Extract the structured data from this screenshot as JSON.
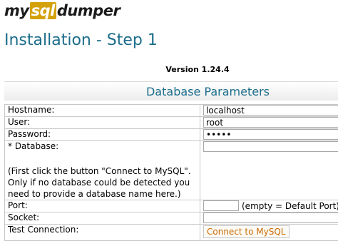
{
  "logo": {
    "part1": "my",
    "part2": "sql",
    "part3": "dumper"
  },
  "page": {
    "title": "Installation - Step 1",
    "version": "Version 1.24.4",
    "section_title": "Database Parameters"
  },
  "form": {
    "hostname_label": "Hostname:",
    "hostname_value": "localhost",
    "user_label": "User:",
    "user_value": "root",
    "password_label": "Password:",
    "password_value": "•••••",
    "database_label": "* Database:",
    "database_value": "",
    "database_note": "(First click the button \"Connect to MySQL\". Only if no database could be detected you need to provide a database name here.)",
    "port_label": "Port:",
    "port_value": "",
    "port_note": "(empty = Default Port)",
    "socket_label": "Socket:",
    "socket_value": "",
    "test_label": "Test Connection:",
    "connect_button": "Connect to MySQL"
  }
}
